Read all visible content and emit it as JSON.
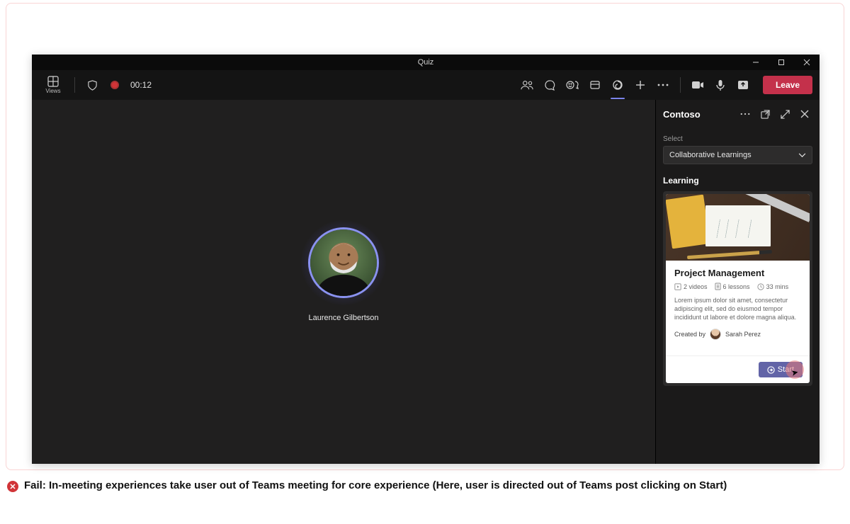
{
  "window": {
    "title": "Quiz"
  },
  "toolbar": {
    "views_label": "Views",
    "timer": "00:12",
    "leave_label": "Leave"
  },
  "stage": {
    "participant_name": "Laurence Gilbertson"
  },
  "panel": {
    "title": "Contoso",
    "select_label": "Select",
    "dropdown_value": "Collaborative Learnings",
    "section_heading": "Learning",
    "card": {
      "title": "Project Management",
      "videos": "2 videos",
      "lessons": "6 lessons",
      "duration": "33 mins",
      "description": "Lorem ipsum dolor sit amet, consectetur adipiscing elit, sed do eiusmod tempor incididunt ut labore et dolore magna aliqua.",
      "created_by_label": "Created by",
      "creator_name": "Sarah Perez",
      "start_label": "Start"
    }
  },
  "fail": {
    "text": "Fail: In-meeting experiences take user out of Teams meeting for core experience (Here, user is directed out of Teams post clicking on Start)"
  }
}
